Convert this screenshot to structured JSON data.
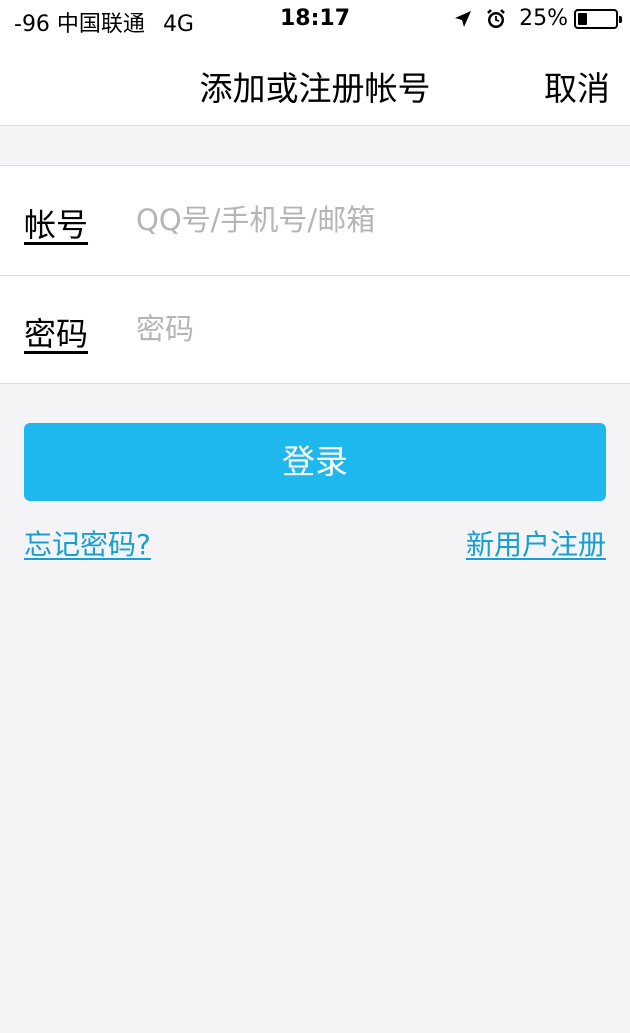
{
  "status_bar": {
    "carrier": "-96 中国联通",
    "network": "4G",
    "time": "18:17",
    "battery": "25%",
    "battery_level": 0.25,
    "icons": [
      "location-arrow-icon",
      "alarm-clock-icon",
      "battery-icon"
    ]
  },
  "nav": {
    "title": "添加或注册帐号",
    "cancel_label": "取消"
  },
  "form": {
    "account_label": "帐号",
    "account_placeholder": "QQ号/手机号/邮箱",
    "account_value": "",
    "password_label": "密码",
    "password_placeholder": "密码",
    "password_value": ""
  },
  "actions": {
    "login_label": "登录",
    "forgot_label": "忘记密码?",
    "register_label": "新用户注册"
  },
  "colors": {
    "accent": "#1fb8ee",
    "link": "#189fd0",
    "background": "#f4f4f7"
  }
}
